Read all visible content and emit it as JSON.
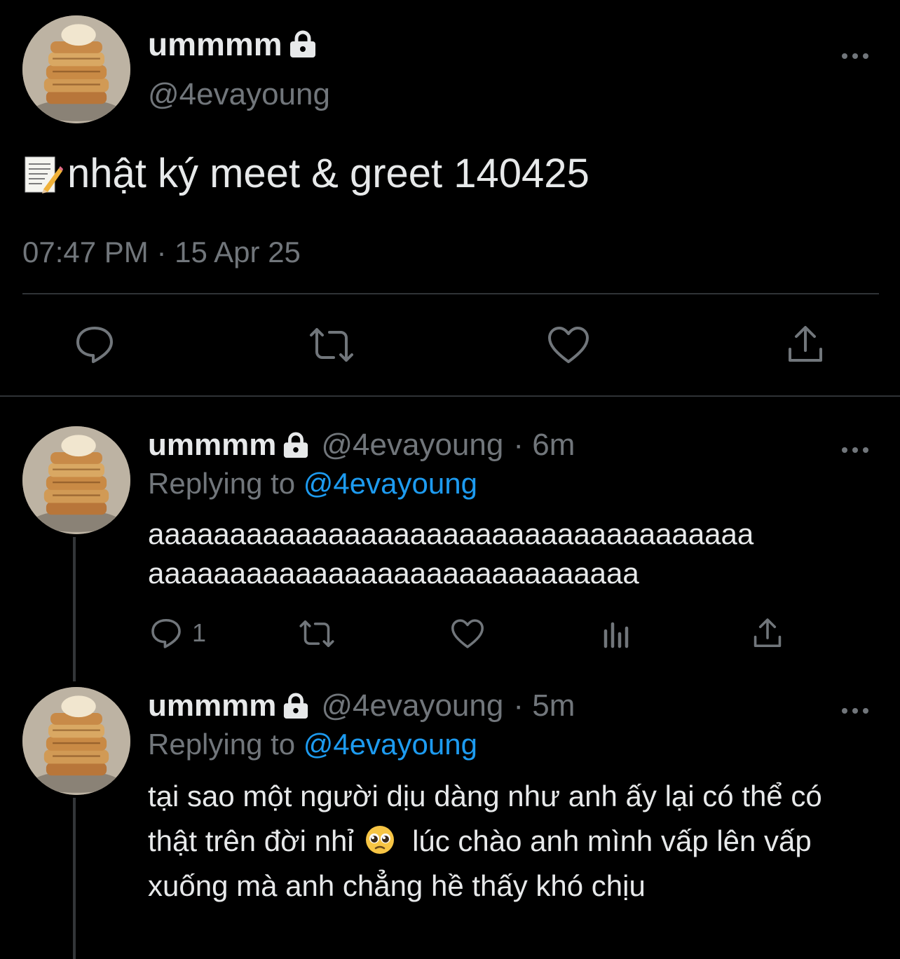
{
  "main_tweet": {
    "display_name": "ummmm",
    "handle": "@4evayoung",
    "text": "nhật ký meet & greet 140425",
    "timestamp": "07:47 PM · 15 Apr 25"
  },
  "replies": [
    {
      "display_name": "ummmm",
      "handle": "@4evayoung",
      "age": "· 6m",
      "replying_prefix": "Replying to",
      "replying_to": "@4evayoung",
      "text_line1": "aaaaaaaaaaaaaaaaaaaaaaaaaaaaaaaaaaaaa",
      "text_line2": "aaaaaaaaaaaaaaaaaaaaaaaaaaaaaa",
      "reply_count": "1"
    },
    {
      "display_name": "ummmm",
      "handle": "@4evayoung",
      "age": "· 5m",
      "replying_prefix": "Replying to",
      "replying_to": "@4evayoung",
      "text_part1": "tại sao một người dịu dàng như anh ấy lại có thể có thật trên đời nhỉ",
      "text_part2": "lúc chào anh mình vấp lên vấp xuống mà anh chẳng hề thấy khó chịu"
    }
  ],
  "icons": {
    "lock": "lock-icon",
    "more": "more-icon",
    "reply": "reply-icon",
    "retweet": "retweet-icon",
    "like": "heart-icon",
    "share": "share-icon",
    "views": "analytics-icon",
    "memo": "memo-emoji",
    "pleading": "pleading-face-emoji"
  },
  "colors": {
    "background": "#000000",
    "text": "#e7e9ea",
    "muted": "#71767b",
    "link": "#1d9bf0",
    "divider": "#2f3336"
  }
}
